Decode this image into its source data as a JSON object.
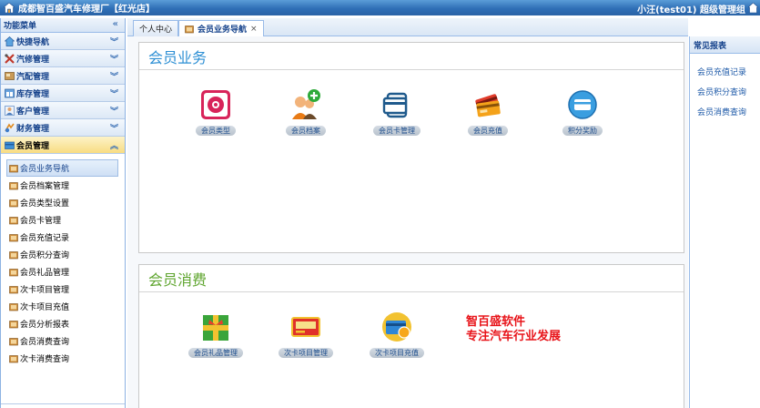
{
  "header": {
    "app_title": "成都智百盛汽车修理厂【红光店】",
    "user_info": "小汪(test01) 超级管理组"
  },
  "sidebar": {
    "title": "功能菜单",
    "collapse_glyph": "«",
    "groups": [
      {
        "label": "快捷导航",
        "icon": "shortcut-icon"
      },
      {
        "label": "汽修管理",
        "icon": "wrench-icon"
      },
      {
        "label": "汽配管理",
        "icon": "parts-icon"
      },
      {
        "label": "库存管理",
        "icon": "warehouse-icon"
      },
      {
        "label": "客户管理",
        "icon": "customer-icon"
      },
      {
        "label": "财务管理",
        "icon": "finance-icon"
      },
      {
        "label": "会员管理",
        "icon": "member-icon",
        "active": true
      }
    ],
    "sub_items": [
      "会员业务导航",
      "会员档案管理",
      "会员类型设置",
      "会员卡管理",
      "会员充值记录",
      "会员积分查询",
      "会员礼品管理",
      "次卡项目管理",
      "次卡项目充值",
      "会员分析报表",
      "会员消费查询",
      "次卡消费查询"
    ]
  },
  "tabs": [
    {
      "label": "个人中心",
      "active": false
    },
    {
      "label": "会员业务导航",
      "active": true,
      "close": "×"
    }
  ],
  "section_business": {
    "title": "会员业务",
    "items": [
      {
        "label": "会员类型",
        "icon": "member-type-icon"
      },
      {
        "label": "会员档案",
        "icon": "member-profile-icon"
      },
      {
        "label": "会员卡管理",
        "icon": "member-card-icon"
      },
      {
        "label": "会员充值",
        "icon": "recharge-icon"
      },
      {
        "label": "积分奖励",
        "icon": "points-reward-icon"
      }
    ]
  },
  "section_consume": {
    "title": "会员消费",
    "items": [
      {
        "label": "会员礼品管理",
        "icon": "gift-icon"
      },
      {
        "label": "次卡项目管理",
        "icon": "punch-card-icon"
      },
      {
        "label": "次卡项目充值",
        "icon": "card-recharge-icon"
      }
    ]
  },
  "slogan": {
    "line1": "智百盛软件",
    "line2": "专注汽车行业发展"
  },
  "right_panel": {
    "title": "常见报表",
    "links": [
      "会员充值记录",
      "会员积分查询",
      "会员消费查询"
    ]
  },
  "colors": {
    "header_blue": "#2f6fb6",
    "business_title": "#2d8fd4",
    "consume_title": "#5fa52f",
    "slogan_red": "#e8141a"
  }
}
